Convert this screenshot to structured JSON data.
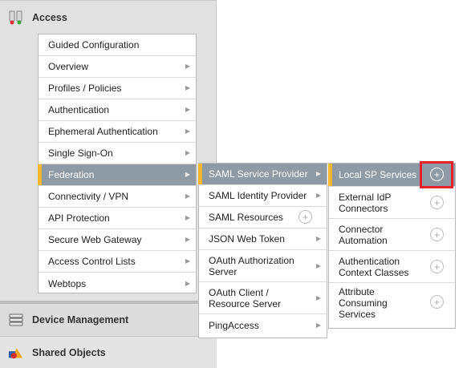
{
  "sidebar": {
    "access": {
      "label": "Access",
      "icon": "access-icon"
    },
    "device_management": {
      "label": "Device Management",
      "icon": "device-icon"
    },
    "shared_objects": {
      "label": "Shared Objects",
      "icon": "shared-objects-icon"
    }
  },
  "menu_level1": [
    {
      "label": "Guided Configuration"
    },
    {
      "label": "Overview"
    },
    {
      "label": "Profiles / Policies"
    },
    {
      "label": "Authentication"
    },
    {
      "label": "Ephemeral Authentication"
    },
    {
      "label": "Single Sign-On"
    },
    {
      "label": "Federation"
    },
    {
      "label": "Connectivity / VPN"
    },
    {
      "label": "API Protection"
    },
    {
      "label": "Secure Web Gateway"
    },
    {
      "label": "Access Control Lists"
    },
    {
      "label": "Webtops"
    }
  ],
  "menu_level2": [
    {
      "label": "SAML Service Provider"
    },
    {
      "label": "SAML Identity Provider"
    },
    {
      "label": "SAML Resources"
    },
    {
      "label": "JSON Web Token"
    },
    {
      "label": "OAuth Authorization Server"
    },
    {
      "label": "OAuth Client / Resource Server"
    },
    {
      "label": "PingAccess"
    }
  ],
  "menu_level3": [
    {
      "label": "Local SP Services"
    },
    {
      "label": "External IdP Connectors"
    },
    {
      "label": "Connector Automation"
    },
    {
      "label": "Authentication Context Classes"
    },
    {
      "label": "Attribute Consuming Services"
    }
  ],
  "colors": {
    "active_bg": "#8e9aa6",
    "active_marker": "#f5b82e",
    "highlight": "#e8202a"
  }
}
